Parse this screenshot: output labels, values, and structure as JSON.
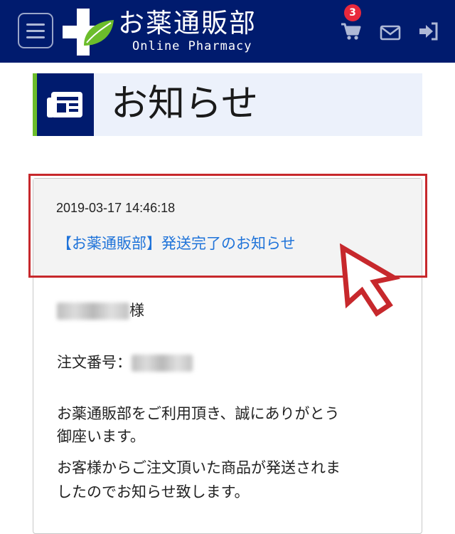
{
  "header": {
    "brand_name": "お薬通販部",
    "brand_sub": "Online Pharmacy",
    "cart_count": "3",
    "bg_color": "#001b6e"
  },
  "icons": {
    "menu": "hamburger-menu-icon",
    "logo": "pharmacy-cross-leaf-icon",
    "cart": "cart-icon",
    "mail": "mail-icon",
    "login": "login-icon",
    "title": "news-icon",
    "pointer": "arrow-pointer-icon"
  },
  "page": {
    "title": "お知らせ"
  },
  "notice": {
    "date": "2019-03-17 14:46:18",
    "subject": "【お薬通販部】発送完了のお知らせ",
    "honorific": "様",
    "order_label": "注文番号：",
    "body_lines": [
      "お薬通販部をご利用頂き、誠にありがとう",
      "御座います。",
      "お客様からご注文頂いた商品が発送されま",
      "したのでお知らせ致します。"
    ]
  },
  "colors": {
    "link": "#1f73d9",
    "highlight": "#c7282c",
    "accent_green": "#6cbd2b",
    "badge": "#e8283c"
  }
}
